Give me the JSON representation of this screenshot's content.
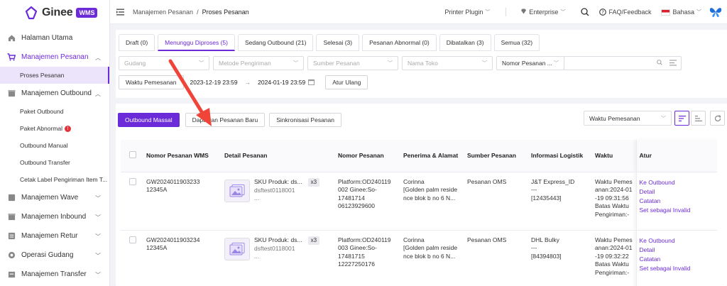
{
  "brand": {
    "name": "Ginee",
    "badge": "WMS"
  },
  "sidebar": {
    "items": [
      {
        "label": "Halaman Utama",
        "icon": "home-icon",
        "type": "group"
      },
      {
        "label": "Manajemen Pesanan",
        "icon": "cart-icon",
        "type": "group",
        "expanded": true,
        "active": true
      },
      {
        "label": "Proses Pesanan",
        "type": "sub",
        "active": true
      },
      {
        "label": "Manajemen Outbound",
        "icon": "box-icon",
        "type": "group",
        "expanded": true
      },
      {
        "label": "Paket Outbound",
        "type": "sub"
      },
      {
        "label": "Paket Abnormal",
        "type": "sub",
        "badge": "!"
      },
      {
        "label": "Outbound Manual",
        "type": "sub"
      },
      {
        "label": "Outbound Transfer",
        "type": "sub"
      },
      {
        "label": "Cetak Label Pengiriman Item T...",
        "type": "sub"
      },
      {
        "label": "Manajemen Wave",
        "icon": "wave-icon",
        "type": "group"
      },
      {
        "label": "Manajemen Inbound",
        "icon": "inbound-icon",
        "type": "group"
      },
      {
        "label": "Manajemen Retur",
        "icon": "return-icon",
        "type": "group"
      },
      {
        "label": "Operasi Gudang",
        "icon": "warehouse-icon",
        "type": "group"
      },
      {
        "label": "Manajemen Transfer",
        "icon": "transfer-icon",
        "type": "group"
      }
    ]
  },
  "header": {
    "breadcrumb": [
      "Manajemen Pesanan",
      "Proses Pesanan"
    ],
    "printer_plugin": "Printer Plugin",
    "enterprise": "Enterprise",
    "faq": "FAQ/Feedback",
    "language": "Bahasa"
  },
  "tabs": [
    {
      "label": "Draft (0)"
    },
    {
      "label": "Menunggu Diproses (5)",
      "active": true
    },
    {
      "label": "Sedang Outbound (21)"
    },
    {
      "label": "Selesai (3)"
    },
    {
      "label": "Pesanan Abnormal (0)"
    },
    {
      "label": "Dibatalkan (3)"
    },
    {
      "label": "Semua (32)"
    }
  ],
  "filters": {
    "gudang": "Gudang",
    "metode": "Metode Pengiriman",
    "sumber": "Sumber Pesanan",
    "toko": "Nama Toko",
    "nomor": "Nomor Pesanan ...",
    "waktu": "Waktu Pemesanan",
    "date_from": "2023-12-19 23:59",
    "date_to": "2024-01-19 23:59",
    "reset": "Atur Ulang"
  },
  "actions": {
    "outbound_massal": "Outbound Massal",
    "dapatkan": "Dapatkan Pesanan Baru",
    "sinkronisasi": "Sinkronisasi Pesanan",
    "sort": "Waktu Pemesanan"
  },
  "table": {
    "headers": [
      "Nomor Pesanan WMS",
      "Detail Pesanan",
      "Nomor Pesanan",
      "Penerima & Alamat",
      "Sumber Pesanan",
      "Informasi Logistik",
      "Waktu",
      "Atur"
    ],
    "rows": [
      {
        "wms": "GW2024011903233 12345A",
        "sku": "SKU Produk: ds...",
        "sku2": "dsftest0118001",
        "ellipsis": "...",
        "qty": "x3",
        "nomor": "Platform:OD240119 002 Ginee:So-17481714 06123929600",
        "penerima": "Corinna",
        "alamat": "[Golden palm reside nce blok b no 6 N...",
        "sumber": "Pesanan OMS",
        "logistik": "J&T Express_ID",
        "log_dash": "---",
        "log_code": "[12435443]",
        "waktu": "Waktu Pemesanan:2024-01-19 09:31:56",
        "batas": "Batas Waktu Pengiriman:-",
        "links": [
          "Ke Outbound",
          "Detail",
          "Catatan",
          "Set sebagai Invalid"
        ]
      },
      {
        "wms": "GW2024011903234 12345A",
        "sku": "SKU Produk: ds...",
        "sku2": "dsftest0118001",
        "ellipsis": "...",
        "qty": "x3",
        "nomor": "Platform:OD240119 003 Ginee:So-17481715 12227250176",
        "penerima": "Corinna",
        "alamat": "[Golden palm reside nce blok b no 6 N...",
        "sumber": "Pesanan OMS",
        "logistik": "DHL Bulky",
        "log_dash": "---",
        "log_code": "[84394803]",
        "waktu": "Waktu Pemesanan:2024-01-19 09:32:22",
        "batas": "Batas Waktu Pengiriman:-",
        "links": [
          "Ke Outbound",
          "Detail",
          "Catatan",
          "Set sebagai Invalid"
        ]
      }
    ]
  },
  "colors": {
    "accent": "#6c2bd9",
    "arrow": "#f04438",
    "badge": "#e5323a"
  }
}
